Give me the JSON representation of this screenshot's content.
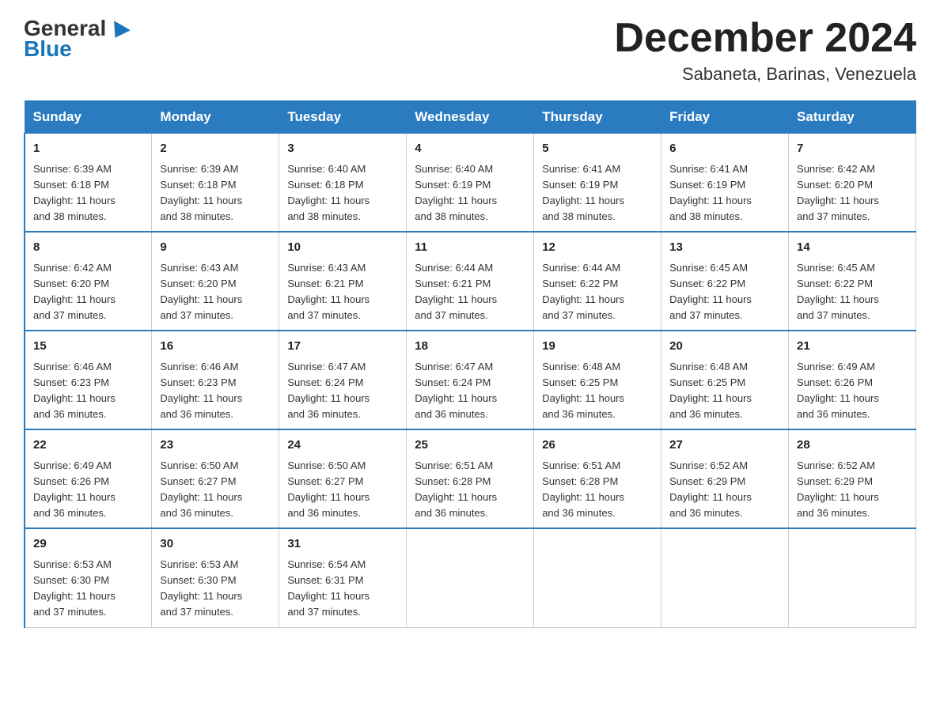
{
  "logo": {
    "general": "General",
    "blue": "Blue"
  },
  "title": "December 2024",
  "location": "Sabaneta, Barinas, Venezuela",
  "headers": [
    "Sunday",
    "Monday",
    "Tuesday",
    "Wednesday",
    "Thursday",
    "Friday",
    "Saturday"
  ],
  "weeks": [
    [
      {
        "day": "1",
        "info": "Sunrise: 6:39 AM\nSunset: 6:18 PM\nDaylight: 11 hours\nand 38 minutes."
      },
      {
        "day": "2",
        "info": "Sunrise: 6:39 AM\nSunset: 6:18 PM\nDaylight: 11 hours\nand 38 minutes."
      },
      {
        "day": "3",
        "info": "Sunrise: 6:40 AM\nSunset: 6:18 PM\nDaylight: 11 hours\nand 38 minutes."
      },
      {
        "day": "4",
        "info": "Sunrise: 6:40 AM\nSunset: 6:19 PM\nDaylight: 11 hours\nand 38 minutes."
      },
      {
        "day": "5",
        "info": "Sunrise: 6:41 AM\nSunset: 6:19 PM\nDaylight: 11 hours\nand 38 minutes."
      },
      {
        "day": "6",
        "info": "Sunrise: 6:41 AM\nSunset: 6:19 PM\nDaylight: 11 hours\nand 38 minutes."
      },
      {
        "day": "7",
        "info": "Sunrise: 6:42 AM\nSunset: 6:20 PM\nDaylight: 11 hours\nand 37 minutes."
      }
    ],
    [
      {
        "day": "8",
        "info": "Sunrise: 6:42 AM\nSunset: 6:20 PM\nDaylight: 11 hours\nand 37 minutes."
      },
      {
        "day": "9",
        "info": "Sunrise: 6:43 AM\nSunset: 6:20 PM\nDaylight: 11 hours\nand 37 minutes."
      },
      {
        "day": "10",
        "info": "Sunrise: 6:43 AM\nSunset: 6:21 PM\nDaylight: 11 hours\nand 37 minutes."
      },
      {
        "day": "11",
        "info": "Sunrise: 6:44 AM\nSunset: 6:21 PM\nDaylight: 11 hours\nand 37 minutes."
      },
      {
        "day": "12",
        "info": "Sunrise: 6:44 AM\nSunset: 6:22 PM\nDaylight: 11 hours\nand 37 minutes."
      },
      {
        "day": "13",
        "info": "Sunrise: 6:45 AM\nSunset: 6:22 PM\nDaylight: 11 hours\nand 37 minutes."
      },
      {
        "day": "14",
        "info": "Sunrise: 6:45 AM\nSunset: 6:22 PM\nDaylight: 11 hours\nand 37 minutes."
      }
    ],
    [
      {
        "day": "15",
        "info": "Sunrise: 6:46 AM\nSunset: 6:23 PM\nDaylight: 11 hours\nand 36 minutes."
      },
      {
        "day": "16",
        "info": "Sunrise: 6:46 AM\nSunset: 6:23 PM\nDaylight: 11 hours\nand 36 minutes."
      },
      {
        "day": "17",
        "info": "Sunrise: 6:47 AM\nSunset: 6:24 PM\nDaylight: 11 hours\nand 36 minutes."
      },
      {
        "day": "18",
        "info": "Sunrise: 6:47 AM\nSunset: 6:24 PM\nDaylight: 11 hours\nand 36 minutes."
      },
      {
        "day": "19",
        "info": "Sunrise: 6:48 AM\nSunset: 6:25 PM\nDaylight: 11 hours\nand 36 minutes."
      },
      {
        "day": "20",
        "info": "Sunrise: 6:48 AM\nSunset: 6:25 PM\nDaylight: 11 hours\nand 36 minutes."
      },
      {
        "day": "21",
        "info": "Sunrise: 6:49 AM\nSunset: 6:26 PM\nDaylight: 11 hours\nand 36 minutes."
      }
    ],
    [
      {
        "day": "22",
        "info": "Sunrise: 6:49 AM\nSunset: 6:26 PM\nDaylight: 11 hours\nand 36 minutes."
      },
      {
        "day": "23",
        "info": "Sunrise: 6:50 AM\nSunset: 6:27 PM\nDaylight: 11 hours\nand 36 minutes."
      },
      {
        "day": "24",
        "info": "Sunrise: 6:50 AM\nSunset: 6:27 PM\nDaylight: 11 hours\nand 36 minutes."
      },
      {
        "day": "25",
        "info": "Sunrise: 6:51 AM\nSunset: 6:28 PM\nDaylight: 11 hours\nand 36 minutes."
      },
      {
        "day": "26",
        "info": "Sunrise: 6:51 AM\nSunset: 6:28 PM\nDaylight: 11 hours\nand 36 minutes."
      },
      {
        "day": "27",
        "info": "Sunrise: 6:52 AM\nSunset: 6:29 PM\nDaylight: 11 hours\nand 36 minutes."
      },
      {
        "day": "28",
        "info": "Sunrise: 6:52 AM\nSunset: 6:29 PM\nDaylight: 11 hours\nand 36 minutes."
      }
    ],
    [
      {
        "day": "29",
        "info": "Sunrise: 6:53 AM\nSunset: 6:30 PM\nDaylight: 11 hours\nand 37 minutes."
      },
      {
        "day": "30",
        "info": "Sunrise: 6:53 AM\nSunset: 6:30 PM\nDaylight: 11 hours\nand 37 minutes."
      },
      {
        "day": "31",
        "info": "Sunrise: 6:54 AM\nSunset: 6:31 PM\nDaylight: 11 hours\nand 37 minutes."
      },
      {
        "day": "",
        "info": ""
      },
      {
        "day": "",
        "info": ""
      },
      {
        "day": "",
        "info": ""
      },
      {
        "day": "",
        "info": ""
      }
    ]
  ]
}
